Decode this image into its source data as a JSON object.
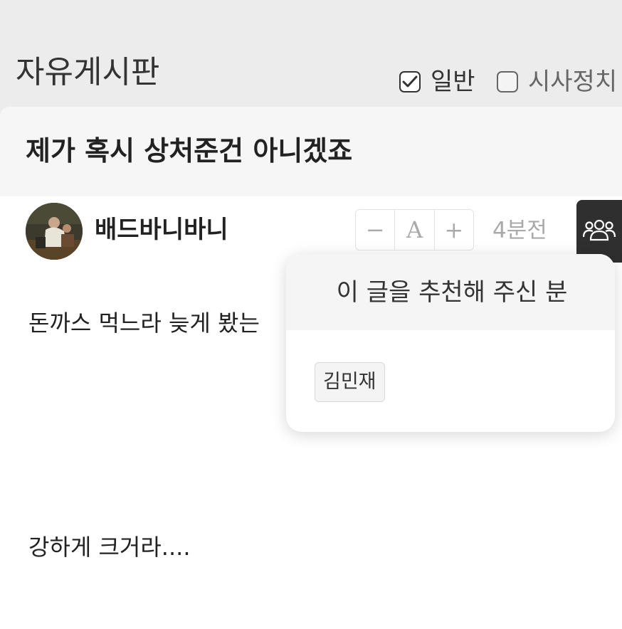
{
  "board": {
    "title": "자유게시판",
    "categories": [
      {
        "label": "일반",
        "checked": true
      },
      {
        "label": "시사정치",
        "checked": false
      }
    ]
  },
  "post": {
    "title": "제가 혹시 상처준건 아니겠죠",
    "author": "배드바니바니",
    "posted_ago": "4분전",
    "font_controls": {
      "decrease": "−",
      "reset": "A",
      "increase": "+"
    },
    "paragraphs": [
      "돈까스 먹느라 늦게 봤는",
      "강하게 크거라...."
    ]
  },
  "recommenders_popover": {
    "title": "이 글을 추천해 주신 분",
    "names": [
      "김민재"
    ]
  },
  "colors": {
    "page_bg": "#ececec",
    "card_bg": "#ffffff",
    "title_bar_bg": "#f6f6f6",
    "dark_button": "#2f2f2f",
    "muted_text": "#aaaaaa"
  },
  "icons": {
    "checkbox_checked": "checkbox-checked-icon",
    "checkbox_unchecked": "checkbox-empty-icon",
    "recommenders": "users-icon"
  }
}
